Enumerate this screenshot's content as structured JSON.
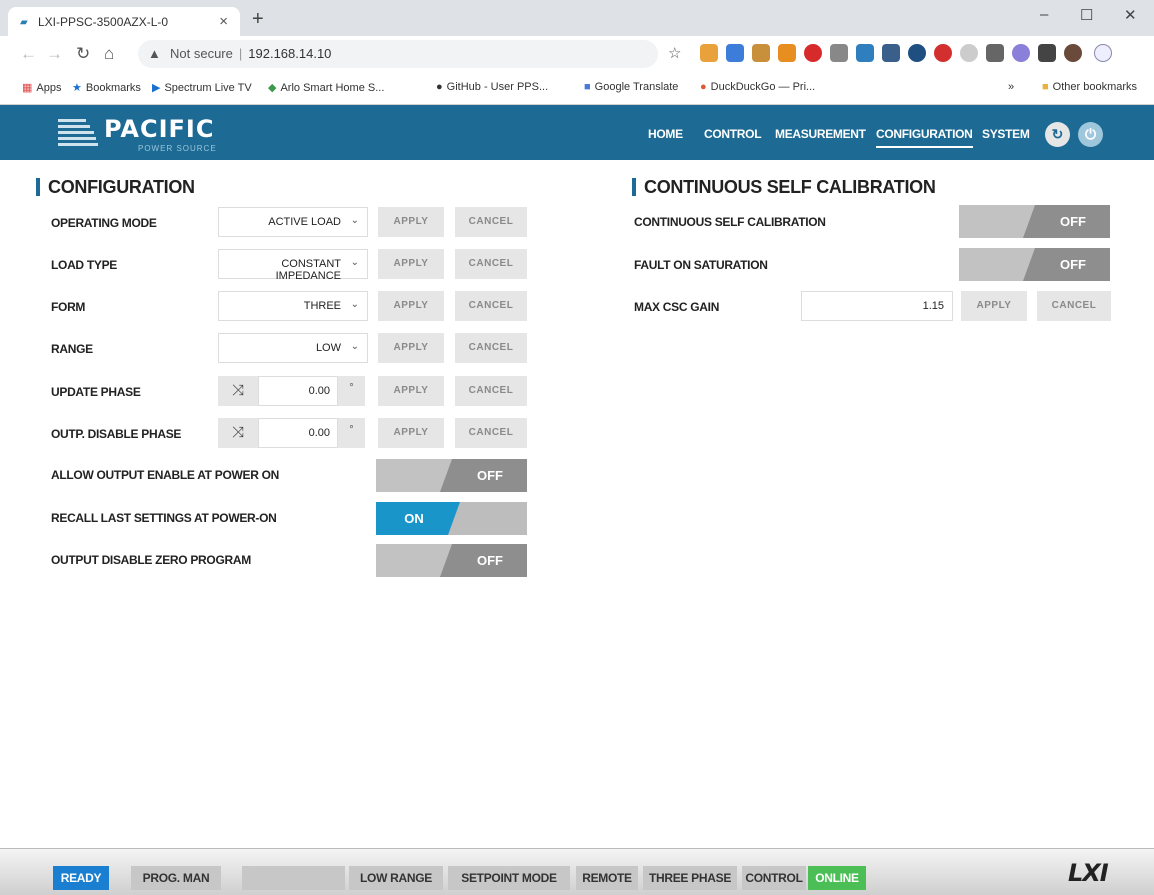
{
  "browser": {
    "tab_title": "LXI-PPSC-3500AZX-L-0",
    "security_label": "Not secure",
    "url": "192.168.14.10",
    "bookmarks": [
      "Apps",
      "Bookmarks",
      "Spectrum Live TV",
      "Arlo Smart Home S...",
      "GitHub - User PPS...",
      "Google Translate",
      "DuckDuckGo — Pri..."
    ],
    "other_bookmarks": "Other bookmarks"
  },
  "header": {
    "brand": "PACIFIC",
    "brand_sub": "POWER SOURCE",
    "nav": [
      "HOME",
      "CONTROL",
      "MEASUREMENT",
      "CONFIGURATION",
      "SYSTEM"
    ],
    "active_nav": "CONFIGURATION"
  },
  "config": {
    "title": "CONFIGURATION",
    "apply": "APPLY",
    "cancel": "CANCEL",
    "operating_mode": {
      "label": "OPERATING MODE",
      "value": "ACTIVE LOAD"
    },
    "load_type": {
      "label": "LOAD TYPE",
      "value": "CONSTANT IMPEDANCE"
    },
    "form": {
      "label": "FORM",
      "value": "THREE"
    },
    "range": {
      "label": "RANGE",
      "value": "LOW"
    },
    "update_phase": {
      "label": "UPDATE PHASE",
      "value": "0.00",
      "unit": "°"
    },
    "outp_disable_phase": {
      "label": "OUTP. DISABLE PHASE",
      "value": "0.00",
      "unit": "°"
    },
    "allow_output": {
      "label": "ALLOW OUTPUT ENABLE AT POWER ON",
      "state": "OFF"
    },
    "recall_last": {
      "label": "RECALL LAST SETTINGS AT POWER-ON",
      "state": "ON"
    },
    "output_disable_zero": {
      "label": "OUTPUT DISABLE ZERO PROGRAM",
      "state": "OFF"
    }
  },
  "csc": {
    "title": "CONTINUOUS SELF CALIBRATION",
    "continuous": {
      "label": "CONTINUOUS SELF CALIBRATION",
      "state": "OFF"
    },
    "fault": {
      "label": "FAULT ON SATURATION",
      "state": "OFF"
    },
    "max_gain": {
      "label": "MAX CSC GAIN",
      "value": "1.15"
    }
  },
  "status_bar": [
    "READY",
    "PROG. MAN",
    "",
    "LOW RANGE",
    "SETPOINT MODE",
    "REMOTE",
    "THREE PHASE",
    "CONTROL",
    "ONLINE"
  ],
  "lxi": "LXI",
  "colors": {
    "header_blue": "#1d6b94",
    "ready_blue": "#1a7fd0",
    "online_green": "#4bbf55",
    "toggle_on": "#1a95c9"
  }
}
